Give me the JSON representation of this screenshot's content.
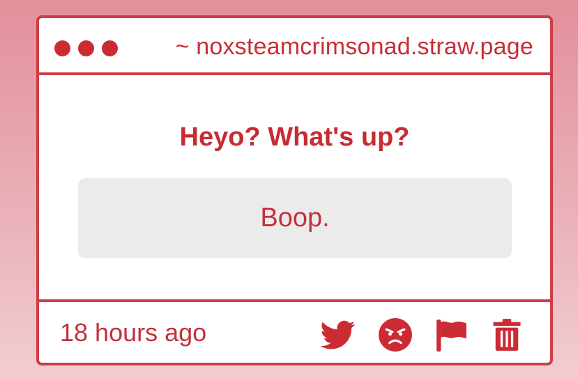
{
  "window": {
    "url": "~ noxsteamcrimsonad.straw.page"
  },
  "post": {
    "question": "Heyo? What's up?",
    "answer": "Boop."
  },
  "footer": {
    "timestamp": "18 hours ago",
    "actions": [
      "twitter-icon",
      "angry-face-icon",
      "flag-icon",
      "trash-icon"
    ]
  },
  "colors": {
    "accent": "#cc2b33",
    "answer_bg": "#ecebec",
    "page_bg_top": "#e38f9a",
    "page_bg_bottom": "#f1cdd2"
  }
}
